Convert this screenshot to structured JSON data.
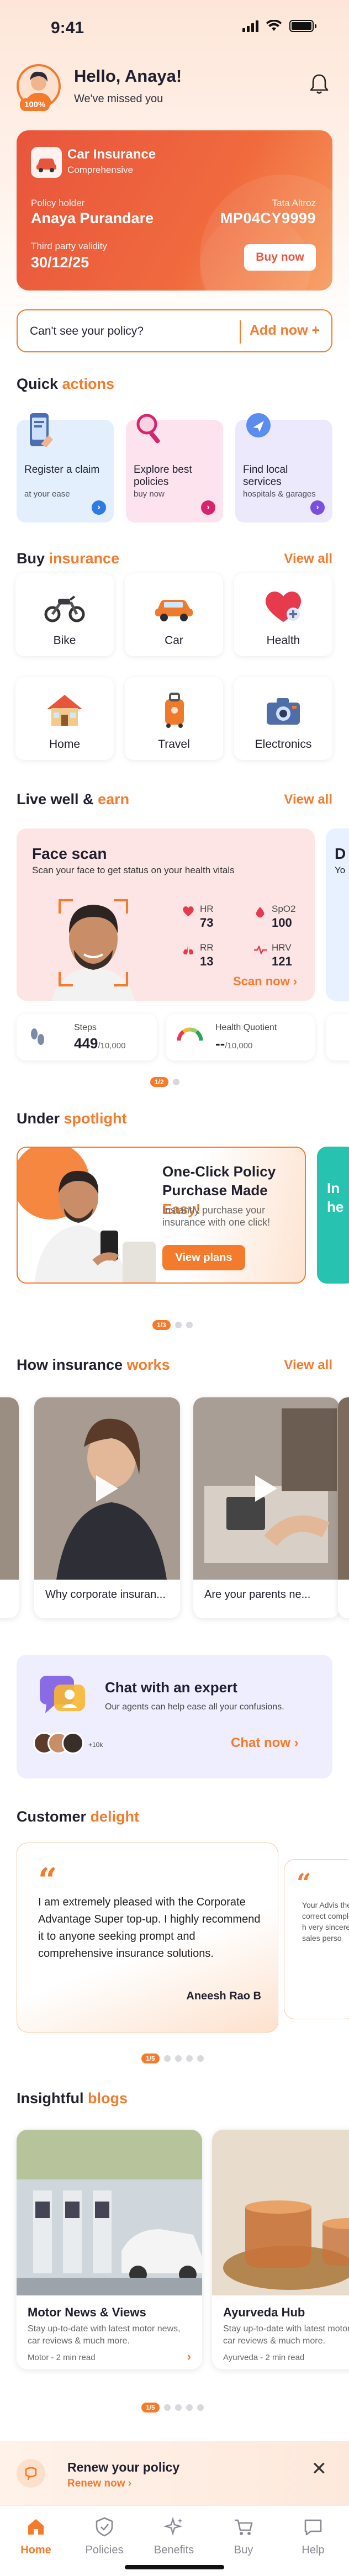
{
  "status_bar": {
    "time": "9:41"
  },
  "header": {
    "greeting": "Hello, Anaya!",
    "subtitle": "We've missed you",
    "avatar_badge": "100%"
  },
  "policy_card": {
    "title": "Car Insurance",
    "subtitle": "Comprehensive",
    "holder_label": "Policy holder",
    "holder_name": "Anaya Purandare",
    "vehicle_label": "Tata Altroz",
    "vehicle_number": "MP04CY9999",
    "validity_label": "Third party validity",
    "validity_date": "30/12/25",
    "buy_now": "Buy now"
  },
  "cant_see": {
    "text": "Can't see your policy?",
    "action": "Add now +"
  },
  "quick_actions": {
    "title_plain": "Quick ",
    "title_accent": "actions",
    "items": [
      {
        "label": "Register a claim",
        "sub": "at your ease",
        "color": "#e3effd",
        "arrow_color": "#2f7be6"
      },
      {
        "label": "Explore best policies",
        "sub": "buy now",
        "color": "#fde3ee",
        "arrow_color": "#d6246e"
      },
      {
        "label": "Find local services",
        "sub": "hospitals & garages",
        "color": "#ece9fd",
        "arrow_color": "#7a4fe0"
      }
    ]
  },
  "buy_insurance": {
    "title_plain": "Buy ",
    "title_accent": "insurance",
    "view_all": "View all",
    "items": [
      {
        "label": "Bike",
        "icon": "bike-icon"
      },
      {
        "label": "Car",
        "icon": "car-icon"
      },
      {
        "label": "Health",
        "icon": "health-heart-icon"
      },
      {
        "label": "Home",
        "icon": "home-icon"
      },
      {
        "label": "Travel",
        "icon": "luggage-icon"
      },
      {
        "label": "Electronics",
        "icon": "camera-icon"
      }
    ]
  },
  "live_well": {
    "title_plain": "Live well & ",
    "title_accent": "earn",
    "view_all": "View all",
    "face_scan": {
      "title": "Face scan",
      "subtitle": "Scan your face to get status on your health vitals",
      "stats": [
        {
          "label": "HR",
          "value": "73"
        },
        {
          "label": "SpO2",
          "value": "100"
        },
        {
          "label": "RR",
          "value": "13"
        },
        {
          "label": "HRV",
          "value": "121"
        }
      ],
      "cta": "Scan now"
    },
    "peek_card_letters": {
      "line1": "D",
      "line2": "Yo"
    },
    "steps": {
      "label": "Steps",
      "value": "449",
      "goal": "/10,000"
    },
    "health_quotient": {
      "label": "Health Quotient",
      "value": "--",
      "goal": "/10,000"
    },
    "pager": "1/2"
  },
  "spotlight": {
    "title_plain": "Under ",
    "title_accent": "spotlight",
    "card": {
      "title_line1": "One-Click Policy",
      "title_line2_plain": "Purchase Made ",
      "title_line2_accent": "Easy!",
      "subtitle": "Instantly purchase your insurance with one click!",
      "cta": "View plans"
    },
    "peek_card_text": {
      "line1": "In",
      "line2": "he"
    },
    "pager": "1/3"
  },
  "how_works": {
    "title_plain": "How insurance ",
    "title_accent": "works",
    "view_all": "View all",
    "videos": [
      {
        "label": "Why corporate insuran..."
      },
      {
        "label": "Are your parents ne..."
      }
    ]
  },
  "chat": {
    "title": "Chat with an expert",
    "subtitle": "Our agents can help ease all your confusions.",
    "count": "+10k",
    "cta": "Chat now"
  },
  "delight": {
    "title_plain": "Customer ",
    "title_accent": "delight",
    "testimonial": {
      "text": "I am extremely pleased with the Corporate Advantage Super top-up. I highly recommend it to anyone seeking prompt and comprehensive insurance solutions.",
      "author": "Aneesh Rao B"
    },
    "peek_text": "Your Advis the correct complete h very sincere sales perso",
    "pager": "1/5"
  },
  "blogs": {
    "title_plain": "Insightful ",
    "title_accent": "blogs",
    "items": [
      {
        "title": "Motor News & Views",
        "sub": "Stay up-to-date with latest motor news, car reviews & much more.",
        "meta": "Motor - 2 min read"
      },
      {
        "title": "Ayurveda Hub",
        "sub": "Stay up-to-date with latest motor news, car reviews & much more.",
        "meta": "Ayurveda - 2 min read"
      }
    ],
    "pager": "1/5"
  },
  "renew": {
    "title": "Renew your policy",
    "cta": "Renew now"
  },
  "bottom_nav": [
    {
      "label": "Home",
      "icon": "home-icon",
      "active": true
    },
    {
      "label": "Policies",
      "icon": "shield-icon",
      "active": false
    },
    {
      "label": "Benefits",
      "icon": "sparkle-icon",
      "active": false
    },
    {
      "label": "Buy",
      "icon": "cart-icon",
      "active": false
    },
    {
      "label": "Help",
      "icon": "chat-icon",
      "active": false
    }
  ],
  "colors": {
    "accent": "#f47a2c",
    "policy_card": "#e8553c"
  }
}
